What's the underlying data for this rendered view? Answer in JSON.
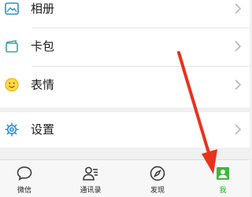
{
  "menu": {
    "items": [
      {
        "label": "相册",
        "icon": "album-icon"
      },
      {
        "label": "卡包",
        "icon": "card-wallet-icon"
      },
      {
        "label": "表情",
        "icon": "smiley-icon"
      }
    ],
    "settings": {
      "label": "设置",
      "icon": "gear-icon"
    }
  },
  "tabbar": {
    "tabs": [
      {
        "label": "微信",
        "icon": "chat-bubble-icon"
      },
      {
        "label": "通讯录",
        "icon": "contacts-icon"
      },
      {
        "label": "发现",
        "icon": "compass-icon"
      },
      {
        "label": "我",
        "icon": "me-icon",
        "active": true
      }
    ]
  },
  "colors": {
    "accent_blue": "#2b8fd6",
    "accent_green": "#1aad19",
    "emoji_yellow": "#f2b705",
    "arrow_red": "#e8321d"
  }
}
